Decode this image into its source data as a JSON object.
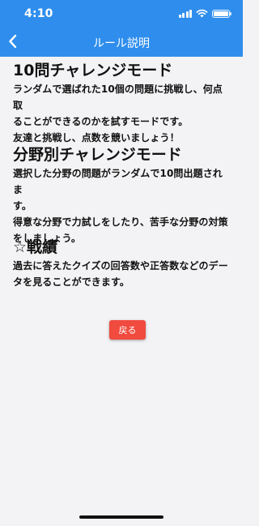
{
  "status_bar": {
    "time": "4:10"
  },
  "nav": {
    "title": "ルール説明",
    "back_icon": "chevron-left-icon"
  },
  "sections": [
    {
      "title": "10問チャレンジモード",
      "body_lines": [
        "ランダムで選ばれた10個の問題に挑戦し、何点取",
        "ることができるのかを試すモードです。",
        "友達と挑戦し、点数を競いましょう！"
      ]
    },
    {
      "title": "分野別チャレンジモード",
      "body_lines": [
        "選択した分野の問題がランダムで10問出題されま",
        "す。",
        "得意な分野で力試しをしたり、苦手な分野の対策",
        "をしましょう。"
      ]
    },
    {
      "title": "☆戦績",
      "body_lines": [
        "過去に答えたクイズの回答数や正答数などのデー",
        "タを見ることができます。"
      ]
    }
  ],
  "return_button": {
    "label": "戻る"
  },
  "colors": {
    "header": "#2f8eed",
    "background": "#f3f3f5",
    "button": "#f14b3f"
  }
}
